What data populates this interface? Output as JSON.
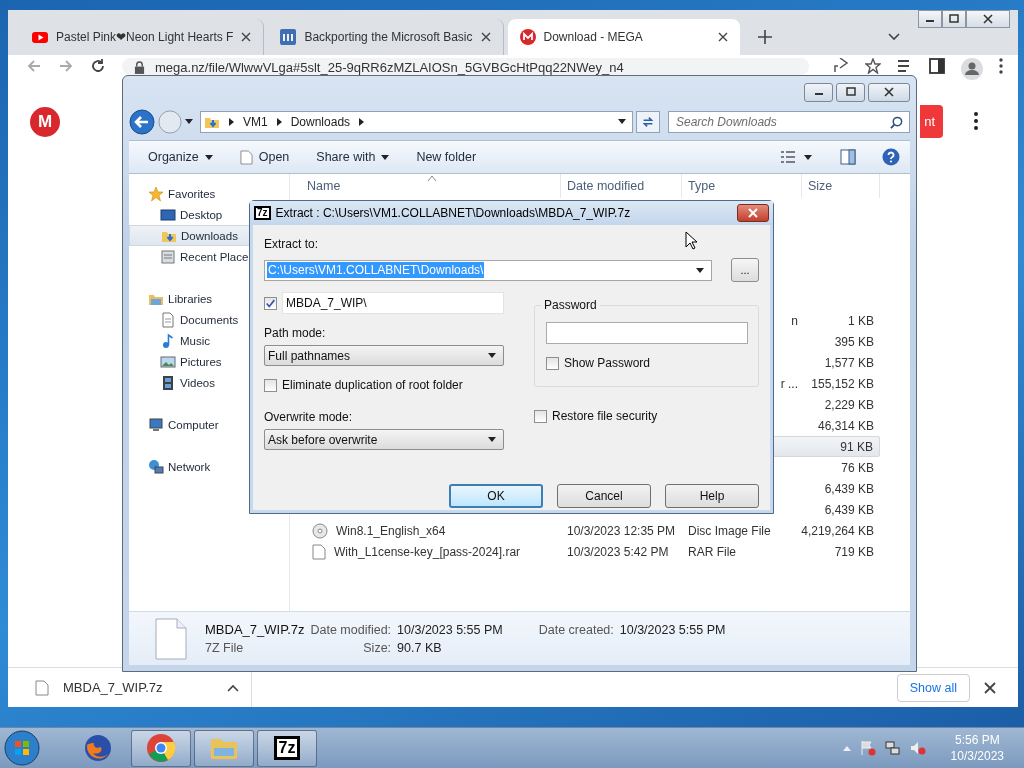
{
  "browser": {
    "tabs": [
      {
        "title": "Pastel Pink❤Neon Light Hearts F",
        "kind": "video",
        "selected": false
      },
      {
        "title": "Backporting the Microsoft Basic",
        "kind": "site",
        "selected": false
      },
      {
        "title": "Download - MEGA",
        "kind": "mega",
        "selected": true
      }
    ],
    "address": "mega.nz/file/WlwwVLga#5slt_25-9qRR6zMZLAIOSn_5GVBGcHtPqq22NWey_n4",
    "page": {
      "logo": "M",
      "button": "nt"
    },
    "download_shelf": {
      "file": "MBDA_7_WIP.7z",
      "show_all": "Show all"
    }
  },
  "explorer": {
    "breadcrumb": [
      "VM1",
      "Downloads"
    ],
    "search": {
      "placeholder": "Search Downloads"
    },
    "commands": [
      {
        "label": "Organize",
        "kind": "menu"
      },
      {
        "label": "Open",
        "kind": "open"
      },
      {
        "label": "Share with",
        "kind": "menu"
      },
      {
        "label": "New folder",
        "kind": "plain"
      }
    ],
    "sidebar": [
      {
        "label": "Favorites",
        "kind": "favorites",
        "selected": false,
        "children": [
          {
            "label": "Desktop",
            "kind": "desktop",
            "selected": false
          },
          {
            "label": "Downloads",
            "kind": "downloads",
            "selected": true
          },
          {
            "label": "Recent Place",
            "kind": "recent",
            "selected": false
          }
        ]
      },
      {
        "label": "Libraries",
        "kind": "libraries",
        "selected": false,
        "children": [
          {
            "label": "Documents",
            "kind": "documents",
            "selected": false
          },
          {
            "label": "Music",
            "kind": "music",
            "selected": false
          },
          {
            "label": "Pictures",
            "kind": "pictures",
            "selected": false
          },
          {
            "label": "Videos",
            "kind": "videos",
            "selected": false
          }
        ]
      },
      {
        "label": "Computer",
        "kind": "computer",
        "selected": false
      },
      {
        "label": "Network",
        "kind": "network",
        "selected": false
      }
    ],
    "columns": [
      "Name",
      "Date modified",
      "Type",
      "Size"
    ],
    "rows": [
      {
        "type": "n",
        "size": "1 KB",
        "selected": false
      },
      {
        "size": "395 KB",
        "selected": false
      },
      {
        "size": "1,577 KB",
        "selected": false
      },
      {
        "type": "r ...",
        "size": "155,152 KB",
        "selected": false
      },
      {
        "size": "2,229 KB",
        "selected": false
      },
      {
        "size": "46,314 KB",
        "selected": false
      },
      {
        "size": "91 KB",
        "selected": true
      },
      {
        "size": "76 KB",
        "selected": false
      },
      {
        "size": "6,439 KB",
        "selected": false
      },
      {
        "size": "6,439 KB",
        "selected": false
      },
      {
        "kind": "disc",
        "name": "Win8.1_English_x64",
        "date": "10/3/2023 12:35 PM",
        "type": "Disc Image File",
        "size": "4,219,264 KB",
        "selected": false
      },
      {
        "kind": "file",
        "name": "With_L1cense-key_[pass-2024].rar",
        "date": "10/3/2023 5:42 PM",
        "type": "RAR File",
        "size": "719 KB",
        "selected": false
      }
    ],
    "details": {
      "name": "MBDA_7_WIP.7z",
      "type": "7Z File",
      "fields": [
        {
          "label": "Date modified:",
          "value": "10/3/2023 5:55 PM"
        },
        {
          "label": "Size:",
          "value": "90.7 KB"
        },
        {
          "label": "Date created:",
          "value": "10/3/2023 5:55 PM"
        }
      ]
    }
  },
  "dialog": {
    "app_icon": "7z",
    "title": "Extract : C:\\Users\\VM1.COLLABNET\\Downloads\\MBDA_7_WIP.7z",
    "extract_to": {
      "label": "Extract to:",
      "value": "C:\\Users\\VM1.COLLABNET\\Downloads\\",
      "text_selected": true,
      "browse": "..."
    },
    "subfolder": {
      "checked": true,
      "value": "MBDA_7_WIP\\"
    },
    "path_mode": {
      "label": "Path mode:",
      "value": "Full pathnames"
    },
    "eliminate_root": {
      "label": "Eliminate duplication of root folder",
      "checked": false
    },
    "overwrite_mode": {
      "label": "Overwrite mode:",
      "value": "Ask before overwrite"
    },
    "password": {
      "label": "Password",
      "show_password": {
        "label": "Show Password",
        "checked": false
      }
    },
    "restore_security": {
      "label": "Restore file security",
      "checked": false
    },
    "buttons": [
      {
        "label": "OK",
        "default": true
      },
      {
        "label": "Cancel",
        "default": false
      },
      {
        "label": "Help",
        "default": false
      }
    ]
  },
  "taskbar": {
    "apps": [
      {
        "kind": "firefox",
        "running": false
      },
      {
        "kind": "chrome",
        "running": true
      },
      {
        "kind": "folder",
        "running": true
      },
      {
        "kind": "sevenzip",
        "label": "7z",
        "running": true
      }
    ],
    "time": "5:56 PM",
    "date": "10/3/2023"
  }
}
